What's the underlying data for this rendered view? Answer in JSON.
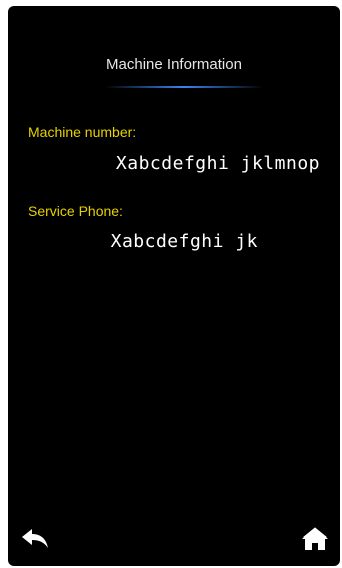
{
  "header": {
    "title": "Machine Information"
  },
  "machine": {
    "number_label": "Machine number:",
    "number_value": "Xabcdefghi jklmnop",
    "service_label": "Service Phone:",
    "service_value": "Xabcdefghi jk"
  },
  "nav": {
    "back_icon": "back-arrow-icon",
    "home_icon": "home-icon"
  },
  "colors": {
    "background": "#000000",
    "label": "#e6d200",
    "value": "#ffffff",
    "accent": "#3c8cff"
  }
}
